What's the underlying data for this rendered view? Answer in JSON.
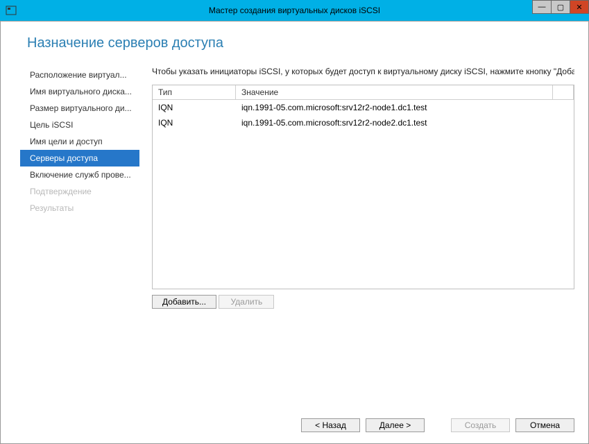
{
  "window": {
    "title": "Мастер создания виртуальных дисков iSCSI"
  },
  "page": {
    "heading": "Назначение серверов доступа",
    "instruction": "Чтобы указать инициаторы iSCSI, у которых будет доступ к виртуальному диску iSCSI, нажмите кнопку \"Доба"
  },
  "sidebar": {
    "items": [
      {
        "label": "Расположение виртуал...",
        "state": "normal"
      },
      {
        "label": "Имя виртуального диска...",
        "state": "normal"
      },
      {
        "label": "Размер виртуального ди...",
        "state": "normal"
      },
      {
        "label": "Цель iSCSI",
        "state": "normal"
      },
      {
        "label": "Имя цели и доступ",
        "state": "normal"
      },
      {
        "label": "Серверы доступа",
        "state": "active"
      },
      {
        "label": "Включение служб прове...",
        "state": "normal"
      },
      {
        "label": "Подтверждение",
        "state": "disabled"
      },
      {
        "label": "Результаты",
        "state": "disabled"
      }
    ]
  },
  "grid": {
    "columns": {
      "type": "Тип",
      "value": "Значение"
    },
    "rows": [
      {
        "type": "IQN",
        "value": "iqn.1991-05.com.microsoft:srv12r2-node1.dc1.test"
      },
      {
        "type": "IQN",
        "value": "iqn.1991-05.com.microsoft:srv12r2-node2.dc1.test"
      }
    ]
  },
  "buttons": {
    "add": "Добавить...",
    "remove": "Удалить",
    "back": "< Назад",
    "next": "Далее >",
    "create": "Создать",
    "cancel": "Отмена"
  }
}
